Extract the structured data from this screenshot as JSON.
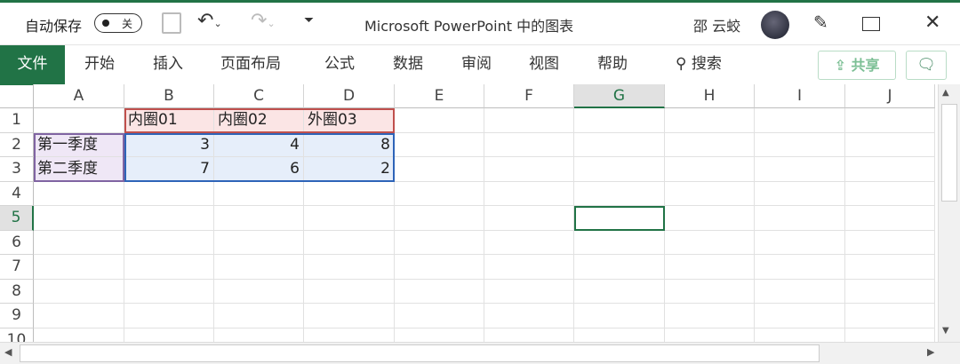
{
  "titlebar": {
    "autosave_label": "自动保存",
    "autosave_state": "关",
    "title": "Microsoft PowerPoint 中的图表",
    "user": "邵 云蛟"
  },
  "ribbon": {
    "tabs": [
      "文件",
      "开始",
      "插入",
      "页面布局",
      "公式",
      "数据",
      "审阅",
      "视图",
      "帮助"
    ],
    "search": "搜索",
    "share": "共享"
  },
  "columns": [
    "A",
    "B",
    "C",
    "D",
    "E",
    "F",
    "G",
    "H",
    "I",
    "J"
  ],
  "rows": [
    "1",
    "2",
    "3",
    "4",
    "5",
    "6",
    "7",
    "8",
    "9",
    "10"
  ],
  "cells": {
    "B1": "内圈01",
    "C1": "内圈02",
    "D1": "外圈03",
    "A2": "第一季度",
    "B2": "3",
    "C2": "4",
    "D2": "8",
    "A3": "第二季度",
    "B3": "7",
    "C3": "6",
    "D3": "2"
  },
  "selected_cell": "G5"
}
